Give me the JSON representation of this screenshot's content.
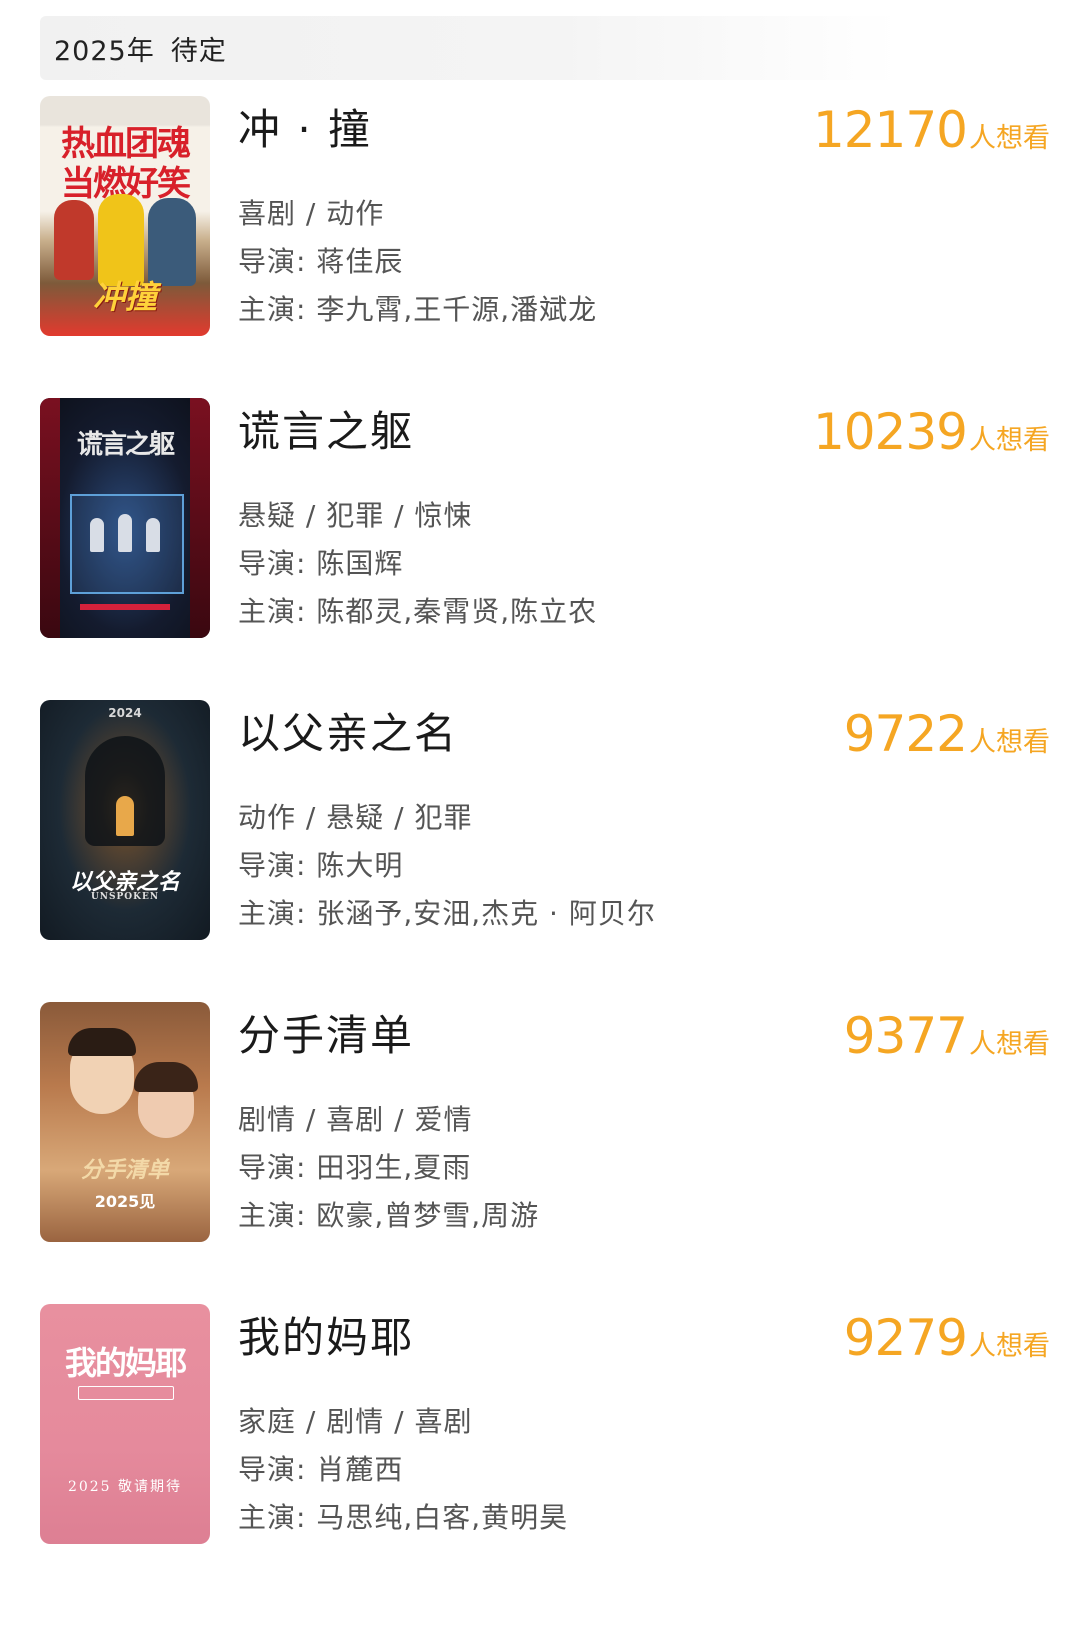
{
  "section": {
    "year": "2025年",
    "status": "待定"
  },
  "movies": [
    {
      "title": "冲 · 撞",
      "want_count": "12170",
      "want_unit": "人想看",
      "genre": "喜剧 / 动作",
      "director": "导演: 蒋佳辰",
      "cast": "主演: 李九霄,王千源,潘斌龙",
      "poster": {
        "line1": "热血团魂",
        "line2": "当燃好笑",
        "logo": "冲撞",
        "bg": "#e9e4dc",
        "accent": "#d8202a"
      }
    },
    {
      "title": "谎言之躯",
      "want_count": "10239",
      "want_unit": "人想看",
      "genre": "悬疑 / 犯罪 / 惊悚",
      "director": "导演: 陈国辉",
      "cast": "主演: 陈都灵,秦霄贤,陈立农",
      "poster": {
        "logo": "谎言之躯",
        "bg": "#121725",
        "accent": "#d4213b"
      }
    },
    {
      "title": "以父亲之名",
      "want_count": "9722",
      "want_unit": "人想看",
      "genre": "动作 / 悬疑 / 犯罪",
      "director": "导演: 陈大明",
      "cast": "主演: 张涵予,安沺,杰克 · 阿贝尔",
      "poster": {
        "year": "2024",
        "logo": "以父亲之名",
        "sub": "UNSPOKEN",
        "bg": "#1d2a35",
        "accent": "#e8a84a"
      }
    },
    {
      "title": "分手清单",
      "want_count": "9377",
      "want_unit": "人想看",
      "genre": "剧情 / 喜剧 / 爱情",
      "director": "导演: 田羽生,夏雨",
      "cast": "主演: 欧豪,曾梦雪,周游",
      "poster": {
        "logo": "分手清单",
        "sub": "2025见",
        "bg": "#b97a4d",
        "accent": "#f3d9a8"
      }
    },
    {
      "title": "我的妈耶",
      "want_count": "9279",
      "want_unit": "人想看",
      "genre": "家庭 / 剧情 / 喜剧",
      "director": "导演: 肖麓西",
      "cast": "主演: 马思纯,白客,黄明昊",
      "poster": {
        "logo": "我的妈耶",
        "sub": "2025 敬请期待",
        "bg": "#e58a9c",
        "accent": "#ffffff"
      }
    }
  ]
}
